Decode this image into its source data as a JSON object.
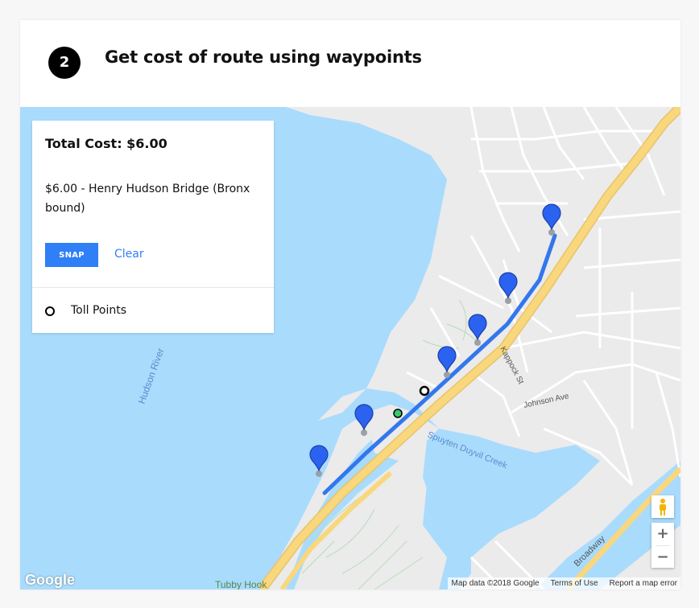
{
  "step": {
    "number": "2",
    "title": "Get cost of route using waypoints"
  },
  "panel": {
    "total_cost": "Total Cost: $6.00",
    "toll_line": "$6.00 - Henry Hudson Bridge (Bronx bound)",
    "snap_label": "SNAP",
    "clear_label": "Clear",
    "legend_label": "Toll Points"
  },
  "map": {
    "labels": {
      "hudson_river": "Hudson River",
      "spuyten": "Spuyten Duyvil Creek",
      "kappock": "Kappock St",
      "johnson": "Johnson Ave",
      "broadway": "Broadway",
      "tubby_hook": "Tubby Hook"
    },
    "google": "Google",
    "attribution": "Map data ©2018 Google",
    "terms": "Terms of Use",
    "report": "Report a map error",
    "zoom_in": "+",
    "zoom_out": "−",
    "colors": {
      "water": "#a9dbfd",
      "land": "#ebebeb",
      "highway": "#f9d77d",
      "route": "#3377ec",
      "marker": "#2b63f0",
      "park_lines": "#b7dbb7"
    },
    "waypoint_count": 6
  }
}
